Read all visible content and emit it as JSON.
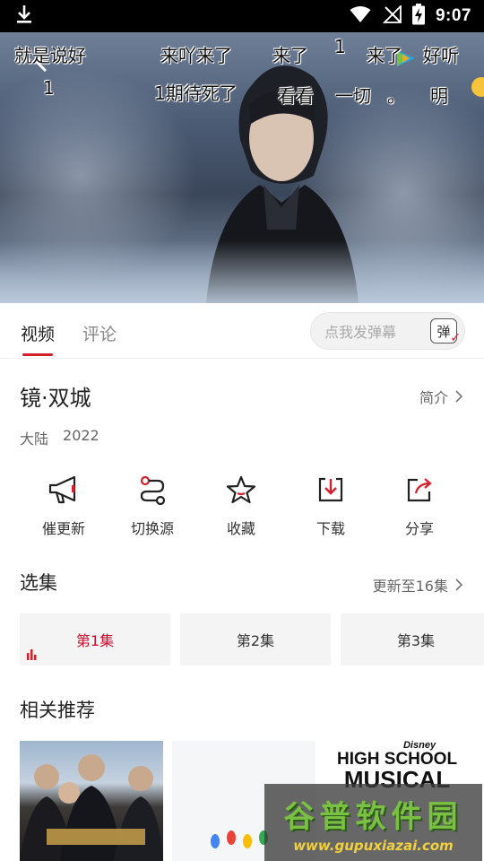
{
  "status_bar": {
    "time": "9:07"
  },
  "player": {
    "danmaku": [
      "就是说好",
      "来吖来了",
      "来了",
      "1",
      "来了",
      "好听",
      "1",
      "1期待死了",
      "看看",
      "一切",
      "。",
      "明"
    ]
  },
  "tabs": {
    "video": "视频",
    "comment": "评论"
  },
  "danmaku_input": {
    "placeholder": "点我发弹幕",
    "toggle_label": "弹"
  },
  "show": {
    "title": "镜·双城",
    "region": "大陆",
    "year": "2022",
    "intro_label": "简介"
  },
  "actions": [
    {
      "label": "催更新",
      "icon": "megaphone-icon"
    },
    {
      "label": "切换源",
      "icon": "switch-source-icon"
    },
    {
      "label": "收藏",
      "icon": "star-icon"
    },
    {
      "label": "下载",
      "icon": "download-icon"
    },
    {
      "label": "分享",
      "icon": "share-icon"
    }
  ],
  "episodes": {
    "title": "选集",
    "update_label": "更新至16集",
    "items": [
      "第1集",
      "第2集",
      "第3集"
    ]
  },
  "recommend": {
    "title": "相关推荐",
    "items": [
      {
        "poster_text": ""
      },
      {
        "poster_text": ""
      },
      {
        "poster_text": [
          "HIGH SCHOOL",
          "MUSICAL"
        ]
      }
    ]
  },
  "watermark": {
    "big": "谷普软件园",
    "small": "www.gupuxiazai.com"
  },
  "colors": {
    "accent": "#d4202e",
    "watermark_green": "#7ac143"
  }
}
